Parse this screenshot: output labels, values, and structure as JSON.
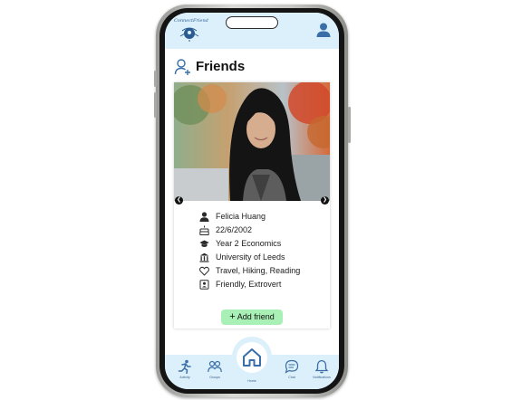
{
  "app": {
    "logo_text": "ConnectFriend"
  },
  "header": {
    "title": "Friends"
  },
  "profile": {
    "name": "Felicia Huang",
    "birthday": "22/6/2002",
    "study_year": "Year 2 Economics",
    "university": "University of Leeds",
    "interests": "Travel, Hiking, Reading",
    "personality": "Friendly, Extrovert"
  },
  "actions": {
    "add_friend_icon": "+",
    "add_friend_label": "Add friend"
  },
  "bottom_nav": {
    "activity": "Activity",
    "groups": "Groups",
    "home": "Home",
    "chat": "Chat",
    "notifications": "Notifications"
  },
  "colors": {
    "nav_bg": "#dcf0fb",
    "accent": "#3a6ea8",
    "add_button": "#a8f0b5"
  },
  "icons": [
    "user-plus-icon",
    "profile-icon",
    "person-icon",
    "cake-icon",
    "graduation-cap-icon",
    "university-icon",
    "heart-icon",
    "contact-card-icon",
    "activity-icon",
    "groups-icon",
    "home-icon",
    "chat-icon",
    "bell-icon",
    "chevron-left-icon",
    "chevron-right-icon"
  ]
}
